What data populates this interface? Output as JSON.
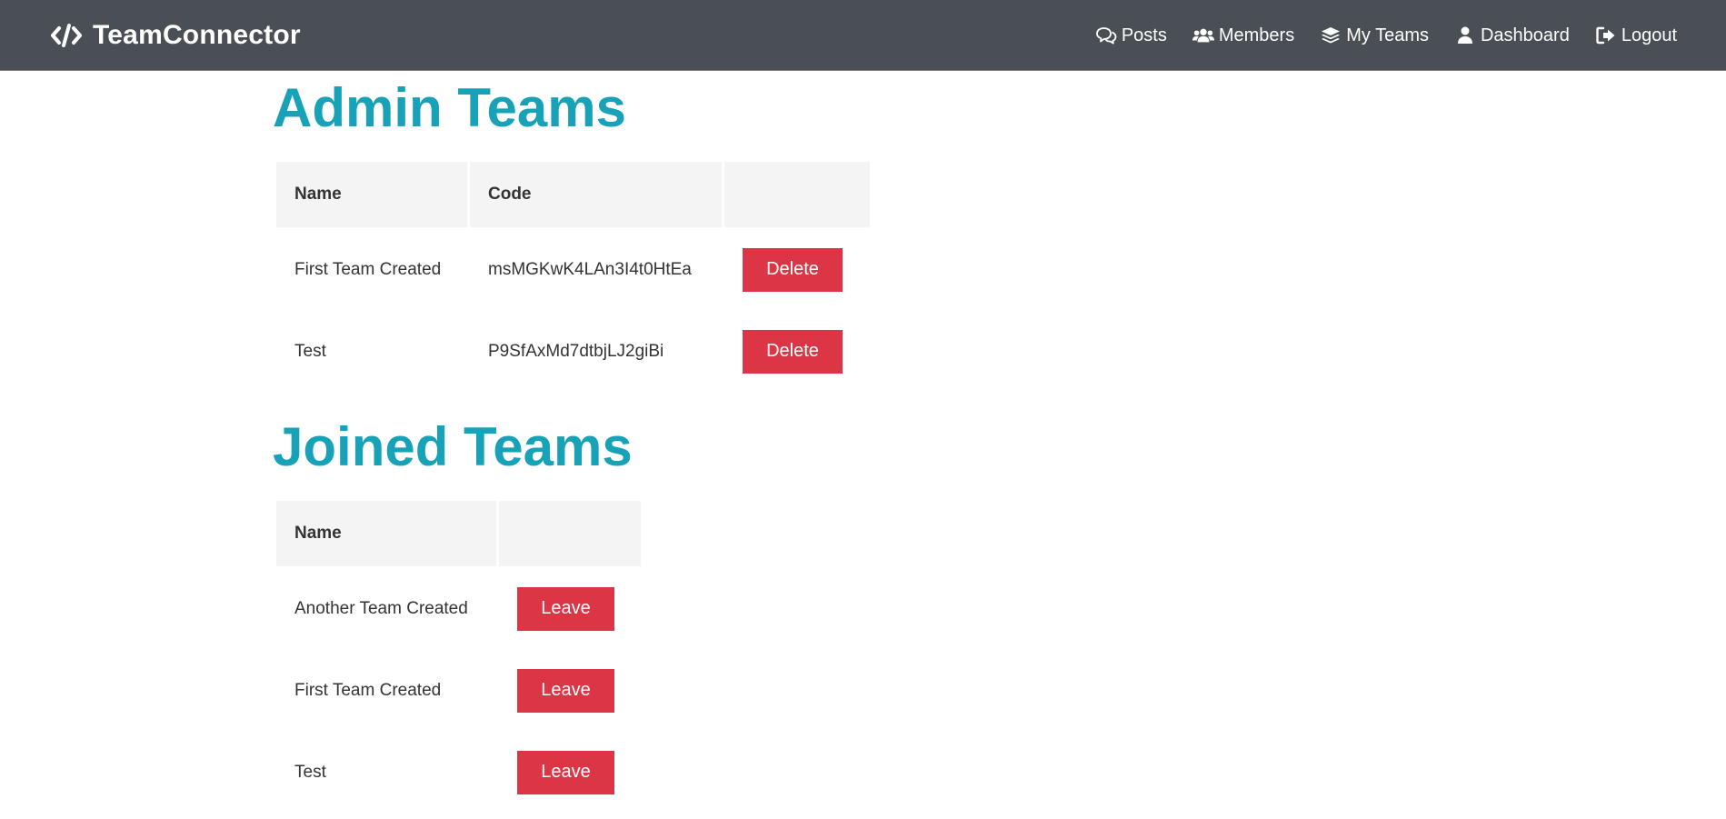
{
  "navbar": {
    "brand": "TeamConnector",
    "brand_icon": "code-icon",
    "links": [
      {
        "label": "Posts",
        "icon": "comments-icon"
      },
      {
        "label": "Members",
        "icon": "users-icon"
      },
      {
        "label": "My Teams",
        "icon": "layers-icon"
      },
      {
        "label": "Dashboard",
        "icon": "user-icon"
      },
      {
        "label": "Logout",
        "icon": "sign-out-icon"
      }
    ],
    "bg_color": "#4a4e55"
  },
  "admin_teams": {
    "title": "Admin Teams",
    "headers": {
      "name": "Name",
      "code": "Code",
      "action": ""
    },
    "rows": [
      {
        "name": "First Team Created",
        "code": "msMGKwK4LAn3I4t0HtEa",
        "action_label": "Delete"
      },
      {
        "name": "Test",
        "code": "P9SfAxMd7dtbjLJ2giBi",
        "action_label": "Delete"
      }
    ]
  },
  "joined_teams": {
    "title": "Joined Teams",
    "headers": {
      "name": "Name",
      "action": ""
    },
    "rows": [
      {
        "name": "Another Team Created",
        "action_label": "Leave"
      },
      {
        "name": "First Team Created",
        "action_label": "Leave"
      },
      {
        "name": "Test",
        "action_label": "Leave"
      }
    ]
  },
  "colors": {
    "accent": "#17a2b8",
    "danger": "#dc3545",
    "header_bg": "#f4f4f4"
  }
}
